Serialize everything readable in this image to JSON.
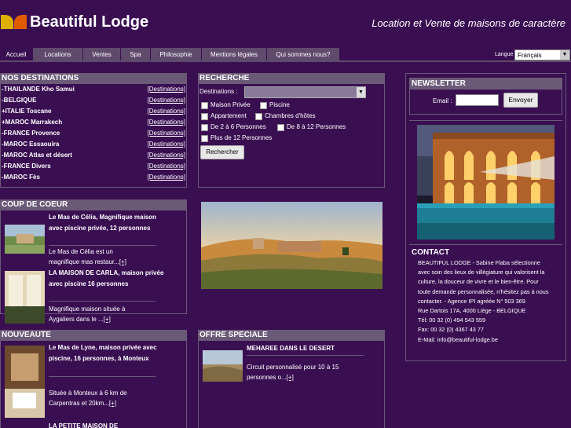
{
  "header": {
    "brand": "Beautiful Lodge",
    "tagline": "Location et Vente de maisons de caractère"
  },
  "nav": {
    "tabs": [
      {
        "label": "Accueil",
        "active": true
      },
      {
        "label": "Locations",
        "active": false
      },
      {
        "label": "Ventes",
        "active": false
      },
      {
        "label": "Spa",
        "active": false
      },
      {
        "label": "Philosophie",
        "active": false
      },
      {
        "label": "Mentions légales",
        "active": false
      },
      {
        "label": "Qui sommes nous?",
        "active": false
      }
    ],
    "language_label": "Langue",
    "language_value": "Français"
  },
  "destinations": {
    "title": "NOS DESTINATIONS",
    "link_label": "[Destinations]",
    "items": [
      "-THAILANDE Kho Samui",
      "-BELGIQUE",
      "+ITALIE Toscane",
      "+MAROC Marrakech",
      "-FRANCE Provence",
      "-MAROC Essaouira",
      "-MAROC Atlas et désert",
      "-FRANCE Divers",
      "-MAROC Fès"
    ]
  },
  "search": {
    "title": "RECHERCHE",
    "destinations_label": "Destinations :",
    "options": [
      "Maison Privée",
      "Piscine",
      "Appartement",
      "Chambres d'hôtes",
      "De 2 à 6 Personnes",
      "De 8 à 12 Personnes",
      "Plus de 12 Personnes"
    ],
    "button": "Rechercher"
  },
  "newsletter": {
    "title": "NEWSLETTER",
    "email_label": "Email :",
    "email_value": "",
    "button": "Envoyer"
  },
  "coup_de_coeur": {
    "title": "COUP DE COEUR",
    "items": [
      {
        "title": "Le Mas de Célia, Magnifique maison avec piscine privée, 12 personnes",
        "text": "Le Mas de Célia est un magnifique mas restaur...",
        "more": "[+]"
      },
      {
        "title": "LA MAISON DE CARLA, maison privée avec piscine 16 personnes",
        "text": "Magnifique maison située à Aygaliers dans le ...",
        "more": "[+]"
      }
    ]
  },
  "nouveaute": {
    "title": "NOUVEAUTE",
    "items": [
      {
        "title": "Le Mas de Lyne, maison privée avec piscine, 16 personnes, à Monteux",
        "text": "Située à Monteux à 6 km de Carpentras et 20km...",
        "more": "[+]"
      },
      {
        "title": "LA PETITE MAISON DE",
        "text": "",
        "more": ""
      }
    ]
  },
  "offre": {
    "title": "OFFRE SPECIALE",
    "item_title": "MEHAREE DANS LE DESERT",
    "item_text": "Circuit personnalisé pour 10 à 15 personnes o...",
    "more": "[+]"
  },
  "contact": {
    "title": "CONTACT",
    "lines": [
      "BEAUTIFUL LODGE - Sabine Flaba sélectionne",
      "avec soin des lieux de villégiature qui valorisent la",
      "culture, la douceur de vivre et le bien-être. Pour",
      "toute demande personnalisée, n'hésitez pas à nous",
      "contacter. - Agence IPI agréée N° 503 369",
      "Rue Dartois 17A, 4000 Liège - BELGIQUE",
      "Tél: 00 32 (0) 494 543 559",
      "Fax: 00 32 (0) 4367 43 77",
      "E-Mail: info@beautiful-lodge.be"
    ]
  }
}
